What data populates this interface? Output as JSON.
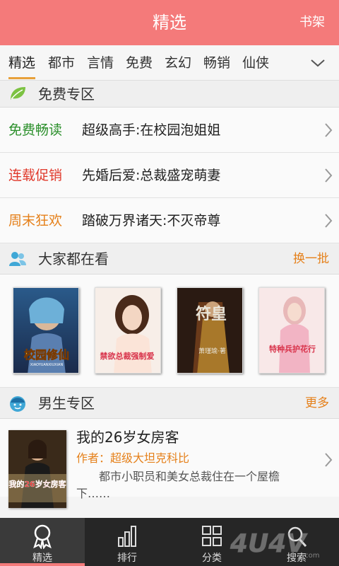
{
  "header": {
    "title": "精选",
    "shelf_label": "书架"
  },
  "tabs": [
    {
      "label": "精选",
      "active": true
    },
    {
      "label": "都市"
    },
    {
      "label": "言情"
    },
    {
      "label": "免费"
    },
    {
      "label": "玄幻"
    },
    {
      "label": "畅销"
    },
    {
      "label": "仙侠"
    }
  ],
  "free_zone": {
    "title": "免费专区",
    "rows": [
      {
        "tag": "免费畅读",
        "tag_color": "#2a8f2a",
        "text": "超级高手:在校园泡姐姐"
      },
      {
        "tag": "连载促销",
        "tag_color": "#e0392b",
        "text": "先婚后爱:总裁盛宠萌妻"
      },
      {
        "tag": "周末狂欢",
        "tag_color": "#e5801a",
        "text": "踏破万界诸天:不灭帝尊"
      }
    ]
  },
  "everyone_reading": {
    "title": "大家都在看",
    "action": "换一批",
    "covers": [
      {
        "title": "校园修仙",
        "subtitle": "XIAOYUANXIUXIAN"
      },
      {
        "title": "禁欲总裁强制爱"
      },
      {
        "title": "符皇",
        "author": "萧瑾瑜·著"
      },
      {
        "title": "特种兵护花行"
      }
    ]
  },
  "male_zone": {
    "title": "男生专区",
    "action": "更多",
    "book": {
      "cover_title": "我的26岁女房客",
      "title": "我的26岁女房客",
      "author": "作者：超级大坦克科比",
      "desc": "都市小职员和美女总裁住在一个屋檐下……"
    }
  },
  "bottom_nav": [
    {
      "label": "精选",
      "active": true
    },
    {
      "label": "排行"
    },
    {
      "label": "分类"
    },
    {
      "label": "搜索"
    }
  ],
  "watermark": {
    "text": "4u4v.com"
  },
  "colors": {
    "header": "#f47a7a",
    "accent": "#e5801a",
    "nav_bg": "#262626"
  }
}
